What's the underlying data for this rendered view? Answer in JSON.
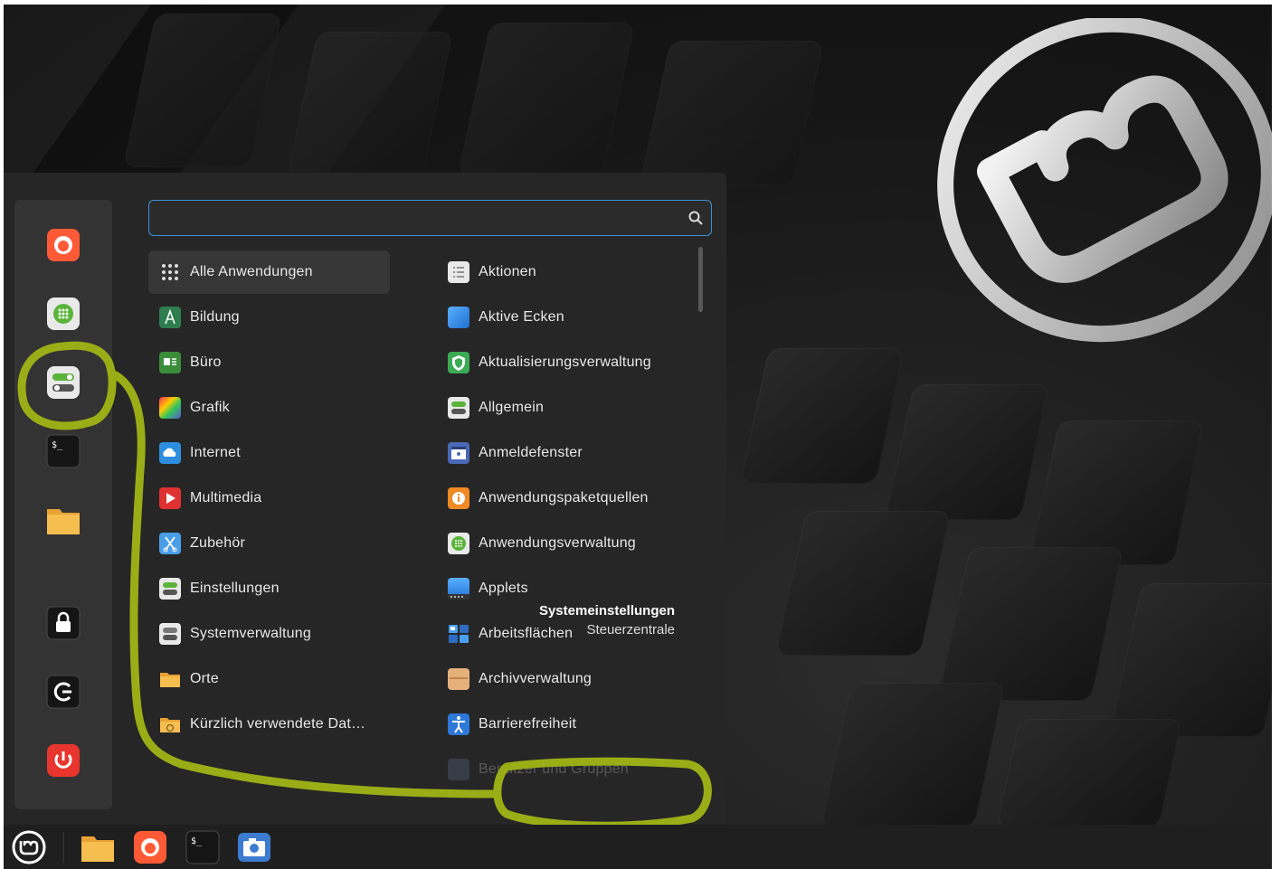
{
  "search": {
    "value": "",
    "placeholder": ""
  },
  "categories": [
    {
      "label": "Alle Anwendungen",
      "icon": "grid-icon"
    },
    {
      "label": "Bildung",
      "icon": "education-icon"
    },
    {
      "label": "Büro",
      "icon": "office-icon"
    },
    {
      "label": "Grafik",
      "icon": "graphics-icon"
    },
    {
      "label": "Internet",
      "icon": "internet-icon"
    },
    {
      "label": "Multimedia",
      "icon": "multimedia-icon"
    },
    {
      "label": "Zubehör",
      "icon": "accessories-icon"
    },
    {
      "label": "Einstellungen",
      "icon": "settings-icon"
    },
    {
      "label": "Systemverwaltung",
      "icon": "administration-icon"
    },
    {
      "label": "Orte",
      "icon": "folder-icon"
    },
    {
      "label": "Kürzlich verwendete Dat…",
      "icon": "recent-files-icon"
    }
  ],
  "apps": [
    {
      "label": "Aktionen",
      "icon": "actions-icon"
    },
    {
      "label": "Aktive Ecken",
      "icon": "hot-corners-icon"
    },
    {
      "label": "Aktualisierungsverwaltung",
      "icon": "update-manager-icon"
    },
    {
      "label": "Allgemein",
      "icon": "general-icon"
    },
    {
      "label": "Anmeldefenster",
      "icon": "login-window-icon"
    },
    {
      "label": "Anwendungspaketquellen",
      "icon": "software-sources-icon"
    },
    {
      "label": "Anwendungsverwaltung",
      "icon": "software-manager-icon"
    },
    {
      "label": "Applets",
      "icon": "applets-icon"
    },
    {
      "label": "Arbeitsflächen",
      "icon": "workspaces-icon"
    },
    {
      "label": "Archivverwaltung",
      "icon": "archive-manager-icon"
    },
    {
      "label": "Barrierefreiheit",
      "icon": "accessibility-icon"
    },
    {
      "label": "Benutzer und Gruppen",
      "icon": "users-groups-icon"
    }
  ],
  "favorites": [
    {
      "name": "firefox-icon"
    },
    {
      "name": "software-manager-icon"
    },
    {
      "name": "system-settings-icon"
    },
    {
      "name": "terminal-icon"
    },
    {
      "name": "files-icon"
    }
  ],
  "session": [
    {
      "name": "lock-screen-icon"
    },
    {
      "name": "logout-icon"
    },
    {
      "name": "power-icon"
    }
  ],
  "tooltip": {
    "title": "Systemeinstellungen",
    "subtitle": "Steuerzentrale"
  },
  "taskbar": [
    {
      "name": "mint-menu-icon"
    },
    {
      "name": "files-icon"
    },
    {
      "name": "firefox-icon"
    },
    {
      "name": "terminal-icon"
    },
    {
      "name": "screenshot-icon"
    }
  ],
  "colors": {
    "menu_bg": "#262626",
    "panel_bg": "#333333",
    "accent": "#3d8fd6",
    "annotation": "#9aad17",
    "firefox": "#ff5a36",
    "power": "#e8352d"
  }
}
